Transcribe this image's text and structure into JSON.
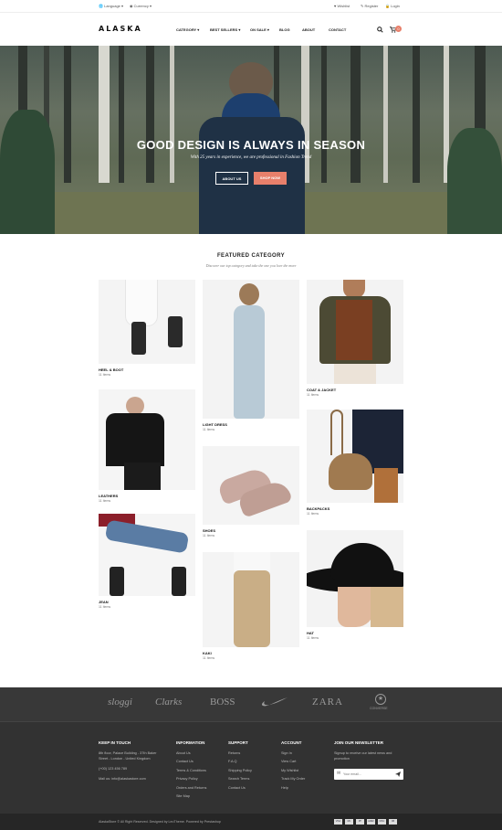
{
  "topbar": {
    "language": "Language",
    "currency": "Currency",
    "wishlist": "Wishlist",
    "register": "Register",
    "login": "Login"
  },
  "header": {
    "logo": "ALASKA",
    "menu": [
      "CATEGORY",
      "BEST SELLERS",
      "ON SALE",
      "BLOG",
      "ABOUT",
      "CONTACT"
    ],
    "cart_count": "0"
  },
  "hero": {
    "title": "GOOD DESIGN IS ALWAYS IN SEASON",
    "subtitle": "With 25 years in experience, we are professional in Fashion Trend",
    "about_label": "ABOUT US",
    "shop_label": "SHOP NOW"
  },
  "featured": {
    "title": "FEATURED CATEGORY",
    "subtitle": "Discover our top category and take the one you love the more",
    "categories": [
      {
        "name": "HEEL & BOOT",
        "count": "11 Items"
      },
      {
        "name": "LEATHERS",
        "count": "11 Items"
      },
      {
        "name": "JEAN",
        "count": "11 Items"
      },
      {
        "name": "LIGHT DRESS",
        "count": "11 Items"
      },
      {
        "name": "SHOES",
        "count": "11 Items"
      },
      {
        "name": "KAKI",
        "count": "11 Items"
      },
      {
        "name": "COAT & JACKET",
        "count": "11 Items"
      },
      {
        "name": "BACKPACKS",
        "count": "11 Items"
      },
      {
        "name": "HAT",
        "count": "11 Items"
      }
    ]
  },
  "brands": [
    "sloggi",
    "Clarks",
    "BOSS",
    "nike-swoosh",
    "ZARA",
    "CONVERSE"
  ],
  "footer": {
    "keep": {
      "title": "KEEP IN TOUCH",
      "address1": "8th floor, Palace Building - 37th Baker",
      "address2": "Street - London - United Kingdom",
      "phone": "(+00) 123 456 789",
      "mail": "Mail us: info@alaskastore.com"
    },
    "information": {
      "title": "INFORMATION",
      "links": [
        "About Us",
        "Contact Us",
        "Terms & Conditions",
        "Privacy Policy",
        "Orders and Returns",
        "Site Map"
      ]
    },
    "support": {
      "title": "SUPPORT",
      "links": [
        "Returns",
        "F.A.Q",
        "Shipping Policy",
        "Search Terms",
        "Contact Us"
      ]
    },
    "account": {
      "title": "ACCOUNT",
      "links": [
        "Sign In",
        "View Cart",
        "My Wishlist",
        "Track My Order",
        "Help"
      ]
    },
    "newsletter": {
      "title": "JOIN OUR NEWSLETTER",
      "text1": "Signup to receive our latest news and",
      "text2": "promotion",
      "placeholder": "Your email..."
    },
    "copyright": "AlaskaStore © All Right Reserved. Designed by LeoTheme. Powered by Prestashop",
    "payments": [
      "VISA",
      "MC",
      "PP",
      "AMEX",
      "DISC",
      "CB"
    ]
  }
}
